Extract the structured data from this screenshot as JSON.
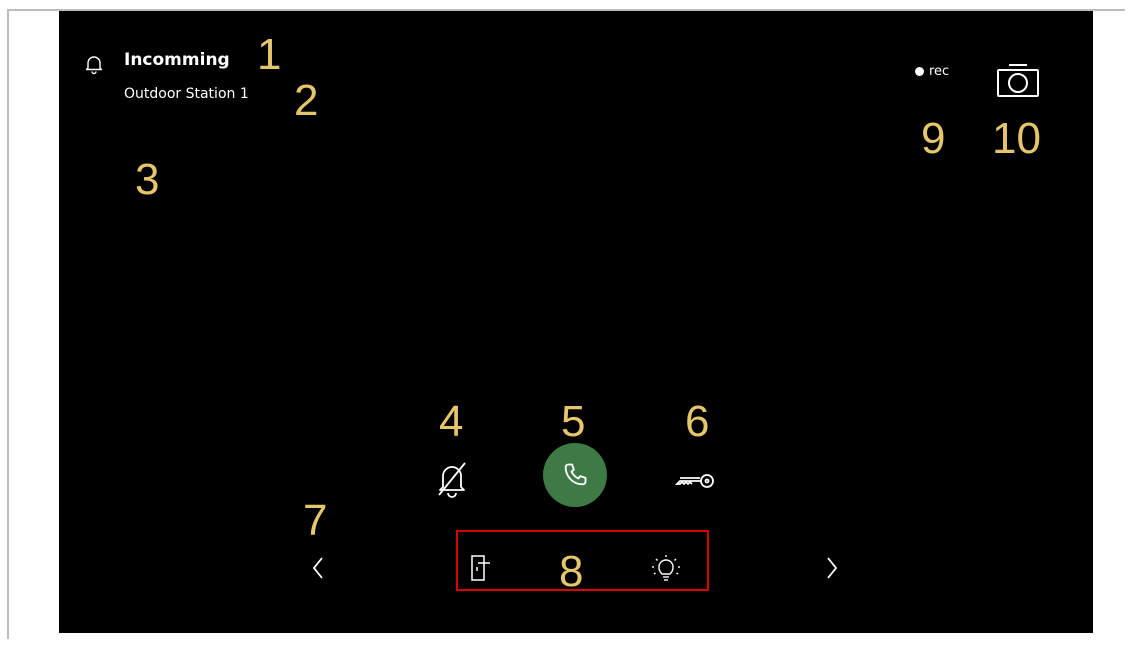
{
  "call": {
    "title": "Incomming",
    "subtitle": "Outdoor Station 1"
  },
  "status": {
    "rec_label": "rec"
  },
  "callouts": [
    "1",
    "2",
    "3",
    "4",
    "5",
    "6",
    "7",
    "8",
    "9",
    "10"
  ],
  "colors": {
    "background": "#000000",
    "accept_call": "#3d7a45",
    "callout": "#e6c66a",
    "highlight": "#d90000"
  },
  "icons": {
    "header": "bell-icon",
    "mute": "bell-off-icon",
    "accept": "phone-icon",
    "unlock": "key-icon",
    "prev": "chevron-left-icon",
    "next": "chevron-right-icon",
    "door": "door-icon",
    "light": "light-bulb-icon",
    "snapshot": "camera-icon"
  }
}
